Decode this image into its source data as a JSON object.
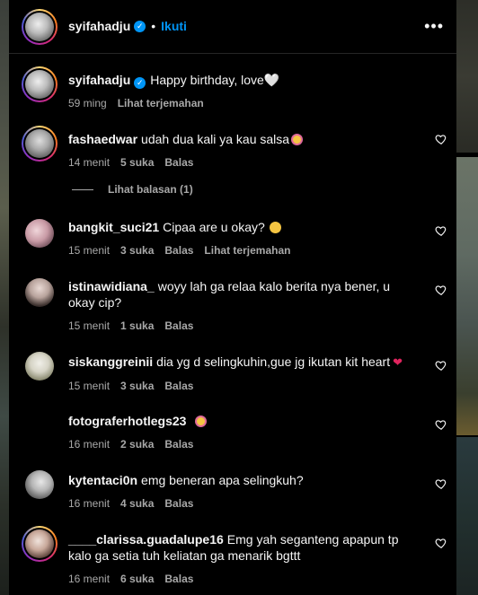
{
  "header": {
    "username": "syifahadju",
    "follow_label": "Ikuti",
    "more_glyph": "•••"
  },
  "caption": {
    "username": "syifahadju",
    "text": "Happy birthday, love🤍",
    "time": "59 ming",
    "translate": "Lihat terjemahan"
  },
  "comments": [
    {
      "username": "fashaedwar",
      "text": "udah dua kali ya kau salsa",
      "emoji": "crying-face",
      "time": "14 menit",
      "likes": "5 suka",
      "reply": "Balas"
    },
    {
      "username": "bangkit_suci21",
      "text": "Cipaa are u okay?",
      "emoji": "anxious-face",
      "time": "15 menit",
      "likes": "3 suka",
      "reply": "Balas",
      "translate": "Lihat terjemahan"
    },
    {
      "username": "istinawidiana_",
      "text": "woyy lah ga relaa kalo berita nya bener, u okay cip?",
      "time": "15 menit",
      "likes": "1 suka",
      "reply": "Balas"
    },
    {
      "username": "siskanggreinii",
      "text": "dia yg d selingkuhin,gue jg ikutan kit heart",
      "emoji": "broken-heart",
      "time": "15 menit",
      "likes": "3 suka",
      "reply": "Balas"
    },
    {
      "username": "fotograferhotlegs23",
      "text": "",
      "emoji": "crying-face",
      "time": "16 menit",
      "likes": "2 suka",
      "reply": "Balas"
    },
    {
      "username": "kytentaci0n",
      "text": "emg beneran apa selingkuh?",
      "time": "16 menit",
      "likes": "4 suka",
      "reply": "Balas"
    },
    {
      "username": "____clarissa.guadalupe16",
      "text": "Emg yah seganteng apapun tp kalo ga setia tuh keliatan ga menarik bgttt",
      "time": "16 menit",
      "likes": "6 suka",
      "reply": "Balas"
    }
  ],
  "replies_label": "Lihat balasan (1)",
  "colors": {
    "accent": "#0095f6",
    "muted": "#a8a8a8",
    "text": "#f5f5f5",
    "background": "#000000"
  }
}
